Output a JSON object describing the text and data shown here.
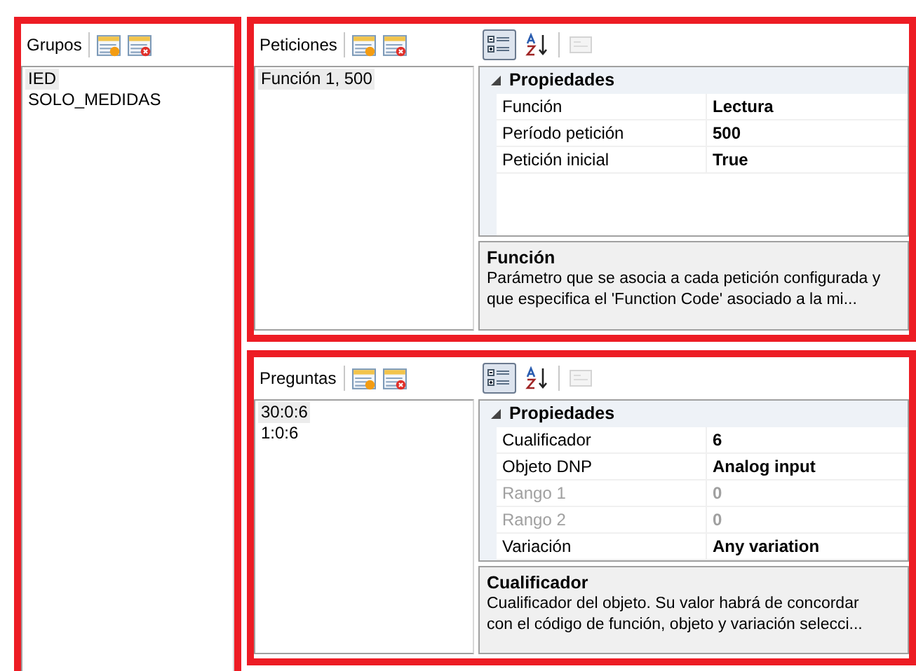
{
  "groups": {
    "title": "Grupos",
    "items": [
      {
        "label": "IED",
        "selected": true
      },
      {
        "label": "SOLO_MEDIDAS",
        "selected": false
      }
    ]
  },
  "sections": [
    {
      "title": "Peticiones",
      "items": [
        {
          "label": "Función 1, 500",
          "selected": true
        }
      ],
      "toolbar": [
        {
          "kind": "categorized",
          "selected": true,
          "disabled": false
        },
        {
          "kind": "alphabetical",
          "selected": false,
          "disabled": false
        },
        {
          "kind": "pages",
          "selected": false,
          "disabled": true
        }
      ],
      "category": {
        "label": "Propiedades",
        "expanded": true
      },
      "properties": [
        {
          "name": "Función",
          "value": "Lectura",
          "disabled": false
        },
        {
          "name": "Período petición",
          "value": "500",
          "disabled": false
        },
        {
          "name": "Petición inicial",
          "value": "True",
          "disabled": false
        }
      ],
      "help": {
        "title": "Función",
        "text": "Parámetro que se asocia a cada petición configurada y que especifica el 'Function Code' asociado a la mi..."
      }
    },
    {
      "title": "Preguntas",
      "items": [
        {
          "label": "30:0:6",
          "selected": true
        },
        {
          "label": "1:0:6",
          "selected": false
        }
      ],
      "toolbar": [
        {
          "kind": "categorized",
          "selected": true,
          "disabled": false
        },
        {
          "kind": "alphabetical",
          "selected": false,
          "disabled": false
        },
        {
          "kind": "pages",
          "selected": false,
          "disabled": true
        }
      ],
      "category": {
        "label": "Propiedades",
        "expanded": true
      },
      "properties": [
        {
          "name": "Cualificador",
          "value": "6",
          "disabled": false
        },
        {
          "name": "Objeto DNP",
          "value": "Analog input",
          "disabled": false
        },
        {
          "name": "Rango 1",
          "value": "0",
          "disabled": true
        },
        {
          "name": "Rango 2",
          "value": "0",
          "disabled": true
        },
        {
          "name": "Variación",
          "value": "Any variation",
          "disabled": false
        }
      ],
      "help": {
        "title": "Cualificador",
        "text": "Cualificador del objeto. Su valor habrá de concordar con el código de función, objeto y variación selecci..."
      }
    }
  ]
}
